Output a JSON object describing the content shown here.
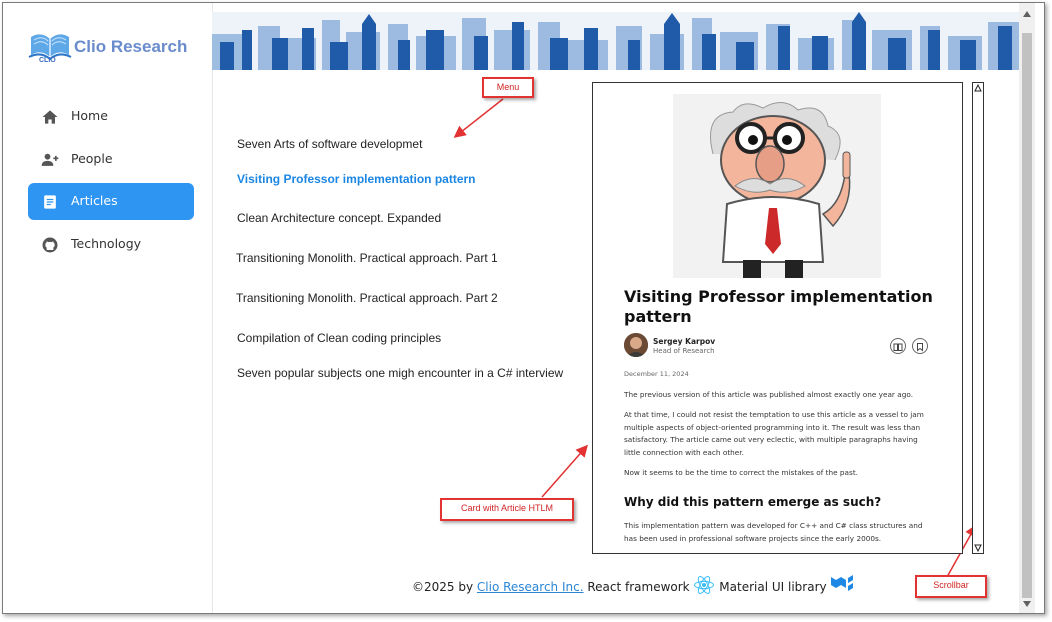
{
  "sidebar": {
    "logo": {
      "text": "Clio Research",
      "sub": "CLIO"
    },
    "items": [
      {
        "label": "Home",
        "icon": "home-icon"
      },
      {
        "label": "People",
        "icon": "person-add-icon"
      },
      {
        "label": "Articles",
        "icon": "article-icon"
      },
      {
        "label": "Technology",
        "icon": "github-icon"
      }
    ]
  },
  "menu": {
    "items": [
      "Seven Arts of software developmet",
      "Visiting Professor implementation pattern",
      "Clean Architecture concept. Expanded",
      "Transitioning Monolith. Practical approach. Part 1",
      "Transitioning Monolith. Practical approach. Part 2",
      "Compilation of Clean coding principles",
      "Seven popular subjects one migh encounter in a C# interview"
    ]
  },
  "callouts": {
    "menu": "Menu",
    "card": "Card with Article HTLM",
    "scrollbar": "Scrollbar"
  },
  "article": {
    "title": "Visiting Professor implementation pattern",
    "author_name": "Sergey Karpov",
    "author_role": "Head of Research",
    "date": "December 11, 2024",
    "paragraphs": [
      "The previous version of this article was published almost exactly one year ago.",
      "At that time, I could not resist the temptation to use this article as a vessel to jam multiple aspects of object-oriented programming into it. The result was less than satisfactory. The article came out very eclectic, with multiple paragraphs having little connection with each other.",
      "Now it seems to be the time to correct the mistakes of the past."
    ],
    "heading": "Why did this pattern emerge as such?",
    "heading_paragraph": "This implementation pattern was developed for C++ and C# class structures and has been used in professional software projects since the early 2000s."
  },
  "footer": {
    "copyright": "©2025 by",
    "company": "Clio Research Inc.",
    "react": "React framework",
    "mui": "Material UI library"
  },
  "colors": {
    "accent": "#2f95f3",
    "callout": "#e23232",
    "link": "#2a85d6"
  }
}
